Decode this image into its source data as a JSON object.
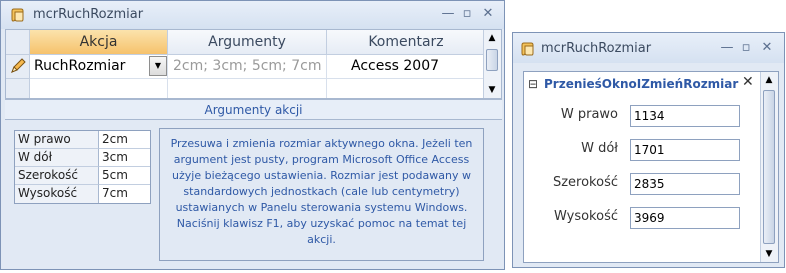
{
  "left_window": {
    "title": "mcrRuchRozmiar",
    "controls": {
      "minimize": "—",
      "maximize": "▫",
      "close": "✕"
    },
    "grid": {
      "columns": [
        "Akcja",
        "Argumenty",
        "Komentarz"
      ],
      "rows": [
        {
          "action": "RuchRozmiar",
          "arguments": "2cm; 3cm; 5cm; 7cm",
          "comment": "Access 2007"
        }
      ],
      "dropdown_glyph": "▼"
    },
    "arguments_title": "Argumenty akcji",
    "arguments": [
      {
        "label": "W prawo",
        "value": "2cm"
      },
      {
        "label": "W dół",
        "value": "3cm"
      },
      {
        "label": "Szerokość",
        "value": "5cm"
      },
      {
        "label": "Wysokość",
        "value": "7cm"
      }
    ],
    "help_text": "Przesuwa i zmienia rozmiar aktywnego okna. Jeżeli ten argument jest pusty, program Microsoft Office Access użyje bieżącego ustawienia. Rozmiar jest podawany w standardowych jednostkach (cale lub centymetry) ustawianych w Panelu sterowania systemu Windows. Naciśnij klawisz F1, aby uzyskać pomoc na temat tej akcji."
  },
  "right_window": {
    "title": "mcrRuchRozmiar",
    "controls": {
      "minimize": "—",
      "maximize": "▫",
      "close": "✕"
    },
    "section_title": "PrzenieśOknoIZmieńRozmiar",
    "collapse_glyph": "⊟",
    "close_glyph": "✕",
    "fields": [
      {
        "label": "W prawo",
        "value": "1134"
      },
      {
        "label": "W dół",
        "value": "1701"
      },
      {
        "label": "Szerokość",
        "value": "2835"
      },
      {
        "label": "Wysokość",
        "value": "3969"
      }
    ]
  },
  "scroll": {
    "up": "▲",
    "down": "▼"
  },
  "colors": {
    "accent_orange": "#f6c26c",
    "label_blue": "#2f59a6",
    "frame": "#e1e9f4"
  }
}
